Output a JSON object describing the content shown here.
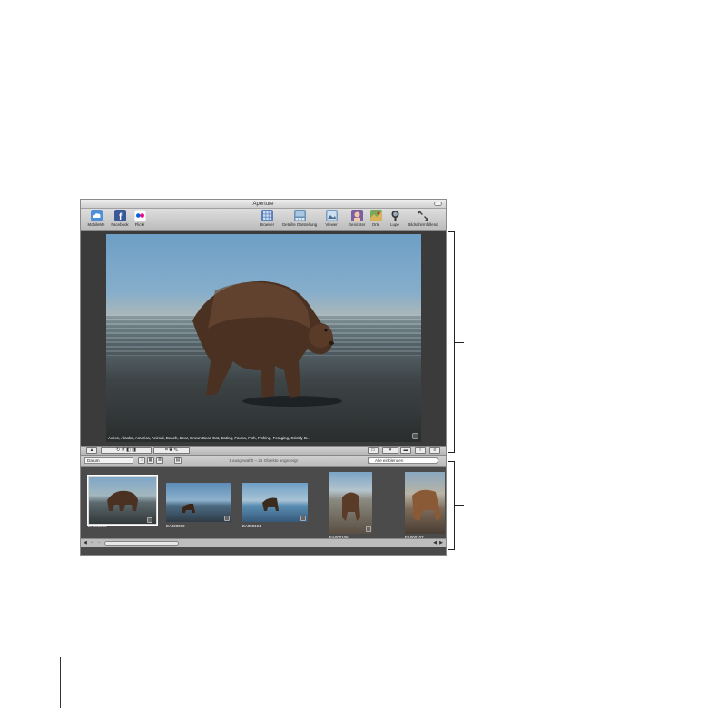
{
  "window": {
    "title": "Aperture"
  },
  "toolbar": {
    "left": [
      {
        "label": "MobileMe",
        "icon": "cloud-icon",
        "color": "#4e8fd8"
      },
      {
        "label": "Facebook",
        "icon": "facebook-icon",
        "color": "#3b5998"
      },
      {
        "label": "Flickr",
        "icon": "flickr-icon",
        "color": "#ffffff"
      }
    ],
    "right": [
      {
        "label": "Browser",
        "icon": "grid-icon",
        "color": "#5b7fb8"
      },
      {
        "label": "Geteilte Darstellung",
        "icon": "split-view-icon",
        "color": "#6a8fb5"
      },
      {
        "label": "Viewer",
        "icon": "viewer-icon",
        "color": "#7a9cbf"
      },
      {
        "label": "Gesichter",
        "icon": "faces-icon",
        "color": "#7b5fa0"
      },
      {
        "label": "Orte",
        "icon": "places-icon",
        "color": "#7aa85a"
      },
      {
        "label": "Lupe",
        "icon": "loupe-icon",
        "color": "#333333"
      },
      {
        "label": "Bildschirmfüllend",
        "icon": "fullscreen-icon",
        "color": "#555555"
      }
    ]
  },
  "viewer": {
    "keywords": "Action, Alaska, America, Animal, Beach, Bear, Brown Bear, Eat, Eating, Fauna, Fish, Fishing, Foraging, Grizzly B..."
  },
  "browser": {
    "sort_value": "Datum",
    "status": "1 ausgewählt – 21 Objekte angezeigt",
    "search_placeholder": "Alle einblenden"
  },
  "thumbnails": [
    {
      "name": "EA000090"
    },
    {
      "name": "EA000069"
    },
    {
      "name": "EA000104"
    },
    {
      "name": "EA000106"
    },
    {
      "name": "EA000107"
    }
  ]
}
